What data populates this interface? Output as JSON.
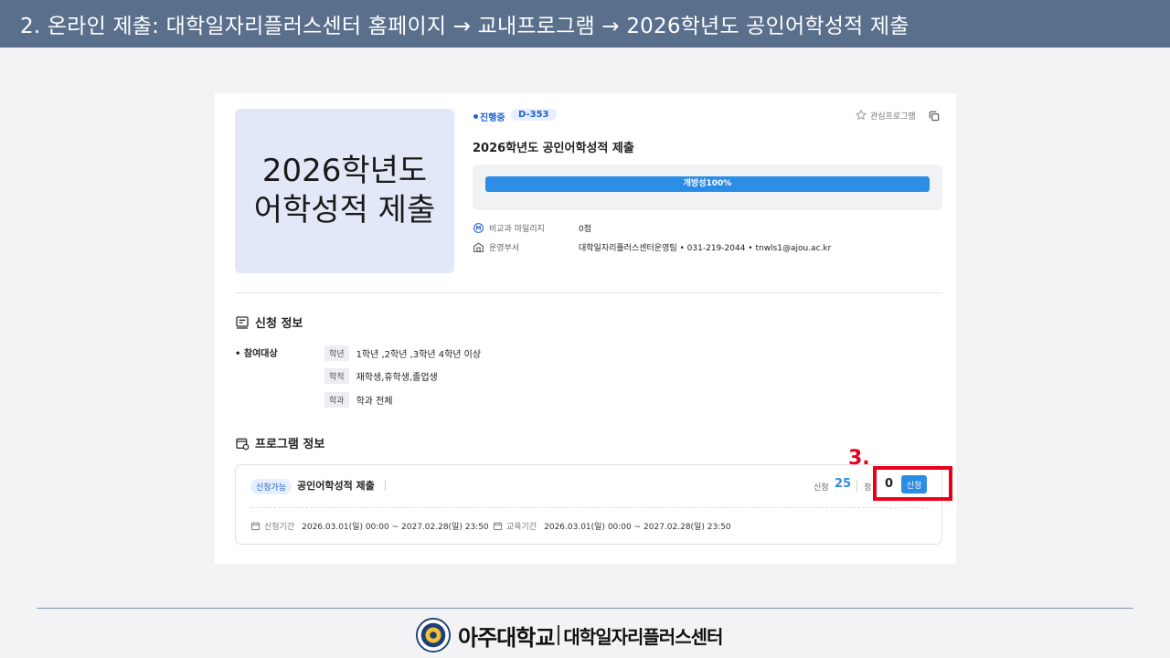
{
  "slide": {
    "header": "2. 온라인 제출: 대학일자리플러스센터 홈페이지 → 교내프로그램 → 2026학년도 공인어학성적 제출",
    "callout": "3.",
    "footer_logo_main": "아주대학교",
    "footer_logo_sub": "대학일자리플러스센터"
  },
  "program": {
    "thumbnail_lines": [
      "2026학년도",
      "어학성적 제출"
    ],
    "status": "진행중",
    "dday": "D-353",
    "favorite_label": "관심프로그램",
    "title": "2026학년도 공인어학성적 제출",
    "progress_label": "개방성100%",
    "progress_fraction": 1.0,
    "mileage_label": "비교과 마일리지",
    "mileage_value": "0점",
    "dept_label": "운영부서",
    "dept_value": "대학일자리플러스센터운영팀 • 031-219-2044 • tnwls1@ajou.ac.kr"
  },
  "apply_info": {
    "section_title": "신청 정보",
    "target_label": "참여대상",
    "rows": [
      {
        "tag": "학년",
        "value": "1학년 ,2학년 ,3학년 4학년 이상"
      },
      {
        "tag": "학적",
        "value": "재학생,휴학생,졸업생"
      },
      {
        "tag": "학과",
        "value": "학과 전체"
      }
    ]
  },
  "program_info": {
    "section_title": "프로그램 정보",
    "badge": "신청가능",
    "title": "공인어학성적 제출",
    "apply_label": "신청",
    "apply_count": "25",
    "quota_label": "정",
    "quota_count": "0",
    "apply_button": "신청",
    "apply_period_label": "신청기간",
    "apply_period": "2026.03.01(일) 00:00 ~ 2027.02.28(일) 23:50",
    "edu_period_label": "교육기간",
    "edu_period": "2026.03.01(일) 00:00 ~ 2027.02.28(일) 23:50"
  },
  "colors": {
    "header_bg": "#5a6f8c",
    "accent": "#2b8de6",
    "highlight": "#e8001c",
    "thumb_bg": "#e2e8f7"
  }
}
